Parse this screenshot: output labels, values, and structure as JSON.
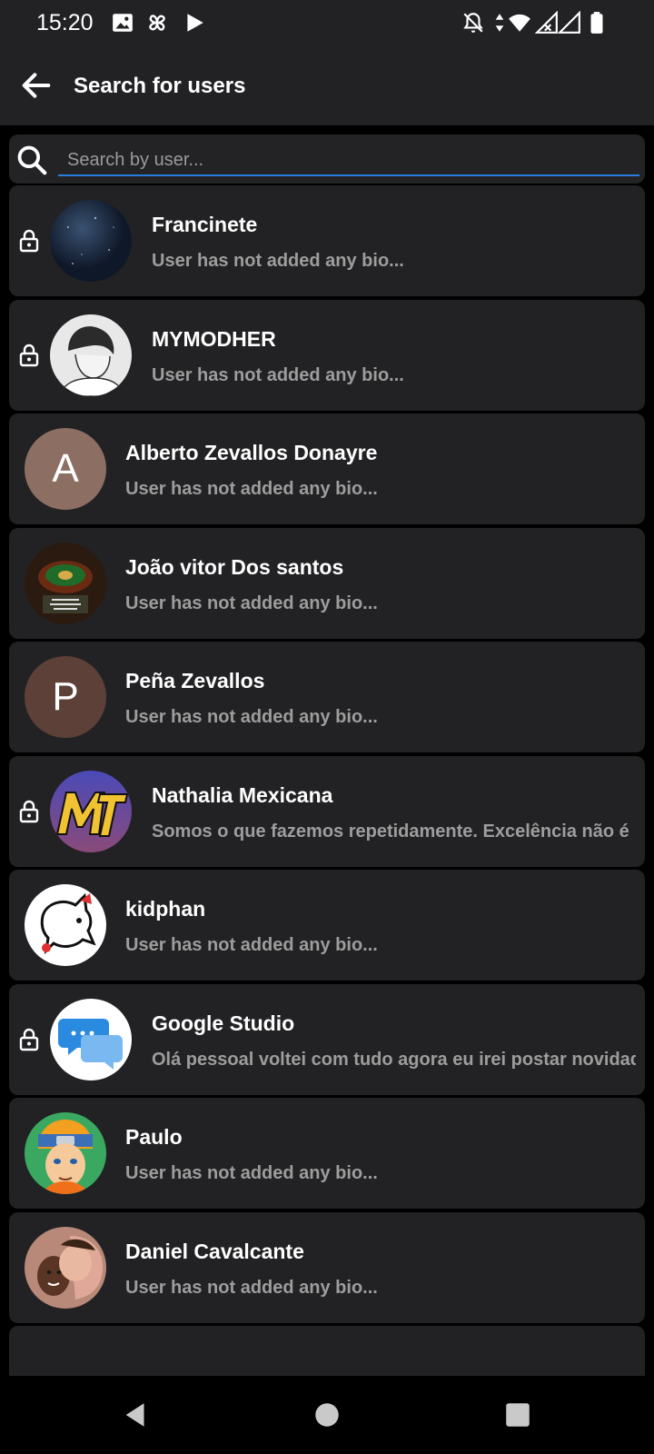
{
  "status": {
    "time": "15:20"
  },
  "appbar": {
    "title": "Search for users",
    "back_icon": "arrow-left-icon"
  },
  "search": {
    "placeholder": "Search by user...",
    "value": "",
    "icon": "search-icon"
  },
  "colors": {
    "background": "#000000",
    "card": "#222224",
    "accent_underline": "#2a7de0",
    "bio_text": "#9d9d9d"
  },
  "users": [
    {
      "name": "Francinete",
      "bio": "User has not added any bio...",
      "locked": true,
      "avatar": "image"
    },
    {
      "name": "MYMODHER",
      "bio": "User has not added any bio...",
      "locked": true,
      "avatar": "image"
    },
    {
      "name": "Alberto Zevallos Donayre",
      "bio": "User has not added any bio...",
      "locked": false,
      "avatar": "letter",
      "letter": "A",
      "avatar_color": "#8d6e63"
    },
    {
      "name": "João vitor Dos santos",
      "bio": "User has not added any bio...",
      "locked": false,
      "avatar": "image"
    },
    {
      "name": "Peña Zevallos",
      "bio": "User has not added any bio...",
      "locked": false,
      "avatar": "letter",
      "letter": "P",
      "avatar_color": "#5d4037"
    },
    {
      "name": "Nathalia Mexicana",
      "bio": "Somos o que fazemos repetidamente. Excelência não é",
      "locked": true,
      "avatar": "image"
    },
    {
      "name": "kidphan",
      "bio": "User has not added any bio...",
      "locked": false,
      "avatar": "image"
    },
    {
      "name": "Google Studio",
      "bio": "Olá pessoal voltei com tudo agora eu irei postar novidades",
      "locked": true,
      "avatar": "image"
    },
    {
      "name": "Paulo",
      "bio": "User has not added any bio...",
      "locked": false,
      "avatar": "image"
    },
    {
      "name": "Daniel Cavalcante",
      "bio": "User has not added any bio...",
      "locked": false,
      "avatar": "image"
    }
  ],
  "navbar": {
    "back": "triangle-back-icon",
    "home": "circle-home-icon",
    "recents": "square-recents-icon"
  }
}
